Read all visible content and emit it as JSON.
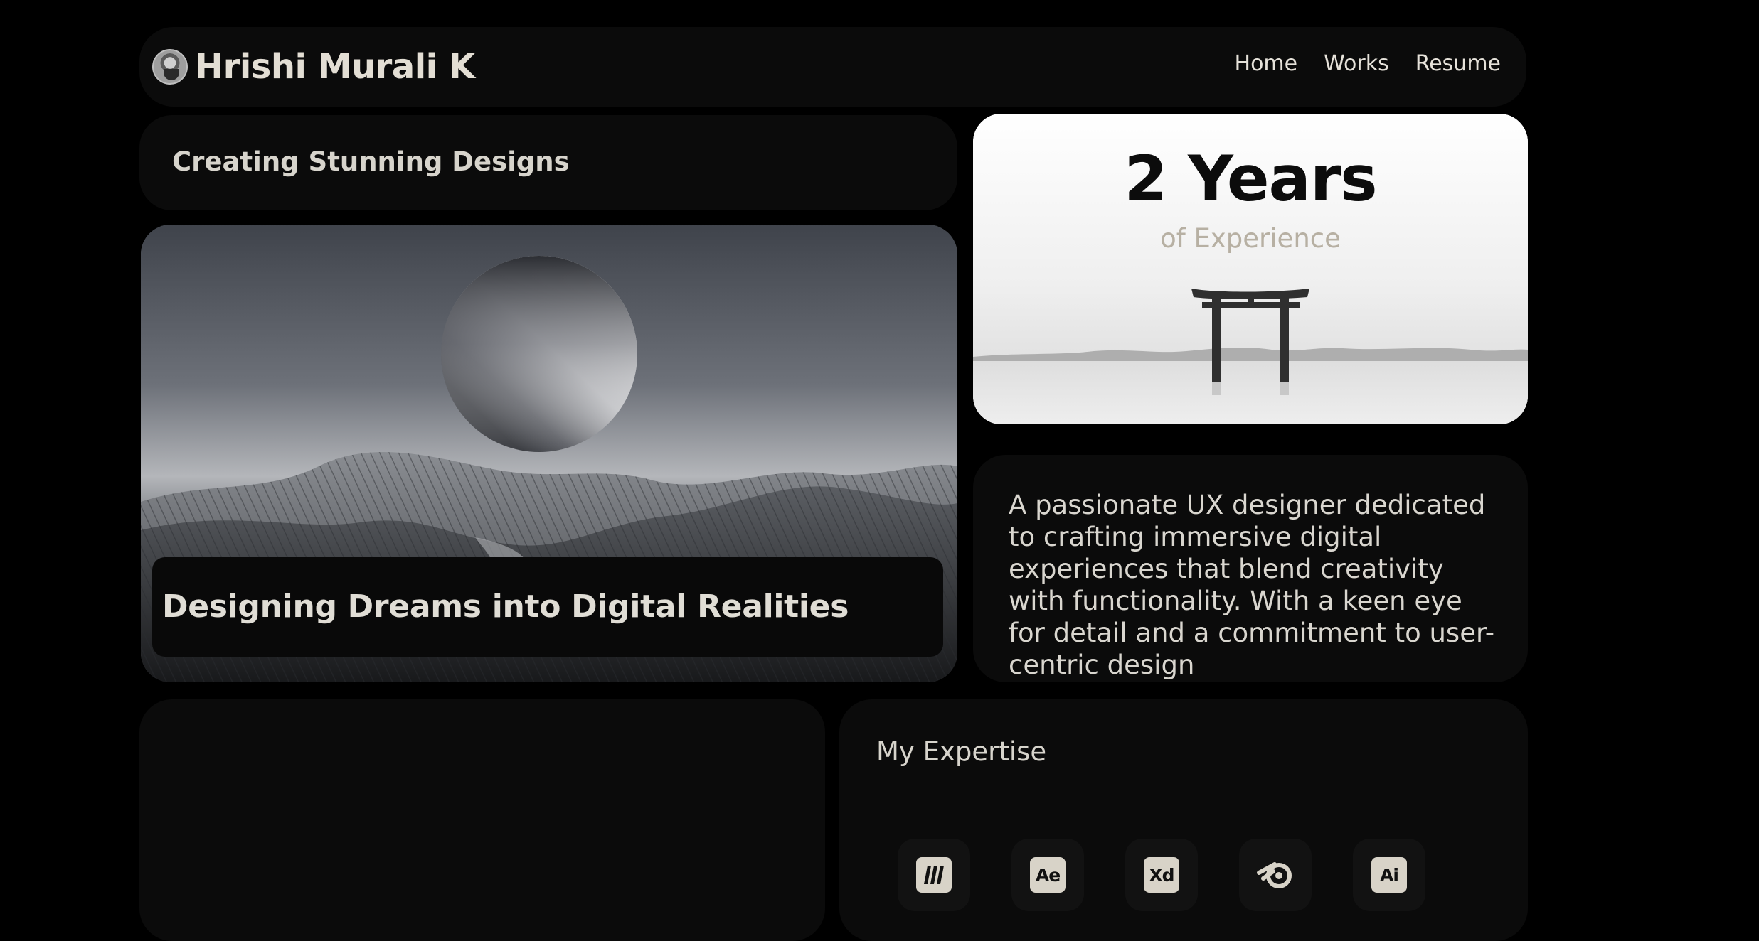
{
  "header": {
    "brand_name": "Hrishi Murali K",
    "avatar_icon": "avatar",
    "nav": [
      {
        "label": "Home"
      },
      {
        "label": "Works"
      },
      {
        "label": "Resume"
      }
    ]
  },
  "hero": {
    "tagline": "Creating Stunning Designs",
    "caption": "Designing Dreams into Digital Realities"
  },
  "experience": {
    "number": "2 Years",
    "label": "of Experience"
  },
  "bio": {
    "text": "A passionate UX designer dedicated to crafting immersive digital experiences that blend creativity with functionality. With a keen eye for detail and a commitment to user-centric design"
  },
  "expertise": {
    "title": "My Expertise",
    "tools": [
      {
        "icon": "miro-icon",
        "badge": ""
      },
      {
        "icon": "after-effects-icon",
        "badge": "Ae"
      },
      {
        "icon": "adobe-xd-icon",
        "badge": "Xd"
      },
      {
        "icon": "blender-icon",
        "badge": ""
      },
      {
        "icon": "illustrator-icon",
        "badge": "Ai"
      }
    ]
  },
  "colors": {
    "background": "#000000",
    "card": "#0b0b0b",
    "text": "#d9d6cf",
    "accent_muted": "#b7b0a3"
  }
}
